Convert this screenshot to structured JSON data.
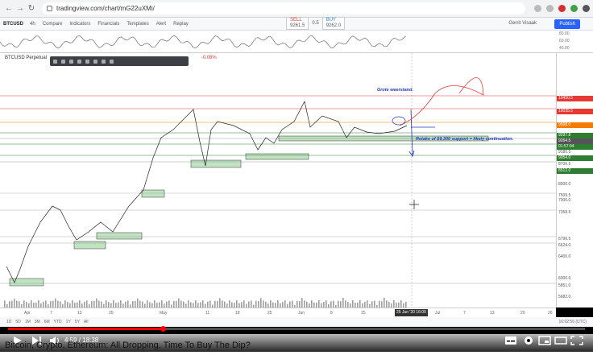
{
  "browser": {
    "url": "tradingview.com/chart/mG22uXMi/"
  },
  "tv": {
    "symbol": "BTCUSD",
    "interval": "4h",
    "toolbar": [
      "Compare",
      "Indicators",
      "Financials",
      "Templates",
      "Alert",
      "Replay"
    ],
    "sell_label": "SELL",
    "sell_price": "9261.5",
    "spread": "0.5",
    "buy_label": "BUY",
    "buy_price": "9262.0",
    "user": "Gerrit Visaak",
    "publish": "Publish",
    "osc_scale": [
      "80.00",
      "60.00",
      "40.00"
    ],
    "chart_title": "BTCUSD Perpetual",
    "chart_sub": "-0.08%",
    "annotation_1": "Grote weerstand.",
    "annotation_2": "Retake of $9,300 support = likely continuation.",
    "price_labels": [
      {
        "t": "10450.5",
        "c": "#e53935"
      },
      {
        "t": "10035.5",
        "c": "#e53935"
      },
      {
        "t": "9598.0",
        "c": "#f57c00"
      },
      {
        "t": "9297.8",
        "c": "#2e7d32"
      },
      {
        "t": "9264.5",
        "c": "#555"
      },
      {
        "t": "01:57:04",
        "c": "#2e7d32"
      },
      {
        "t": "9180.5",
        "c": ""
      },
      {
        "t": "9054.0",
        "c": "#2e7d32"
      },
      {
        "t": "8706.5",
        "c": ""
      },
      {
        "t": "8512.0",
        "c": "#2e7d32"
      },
      {
        "t": "8000.0",
        "c": ""
      },
      {
        "t": "7509.5",
        "c": ""
      },
      {
        "t": "7000.0",
        "c": ""
      },
      {
        "t": "7358.5",
        "c": ""
      },
      {
        "t": "6796.5",
        "c": ""
      },
      {
        "t": "6624.0",
        "c": ""
      },
      {
        "t": "6400.0",
        "c": ""
      },
      {
        "t": "6000.0",
        "c": ""
      },
      {
        "t": "5851.0",
        "c": ""
      },
      {
        "t": "5682.0",
        "c": ""
      }
    ],
    "time_labels": [
      "Apr",
      "7",
      "13",
      "20",
      "May",
      "11",
      "18",
      "25",
      "Jun",
      "8",
      "15",
      "Jul",
      "7",
      "13",
      "20",
      "26"
    ],
    "time_cursor": "25 Jun '20  16:00",
    "ranges": [
      "1D",
      "5D",
      "1M",
      "3M",
      "6M",
      "YTD",
      "1Y",
      "5Y",
      "All"
    ],
    "clock": "16:02:56 (UTC)",
    "bottom_tabs": "Stock Screener   Text Notes   Pine Editor   Strategy Tester   Trading Panel"
  },
  "player": {
    "time": "4:59 / 18:38",
    "progress": 0.268
  },
  "video_title": "Bitcoin, Crypto, Ethereum: All Dropping, Time To Buy The Dip?"
}
